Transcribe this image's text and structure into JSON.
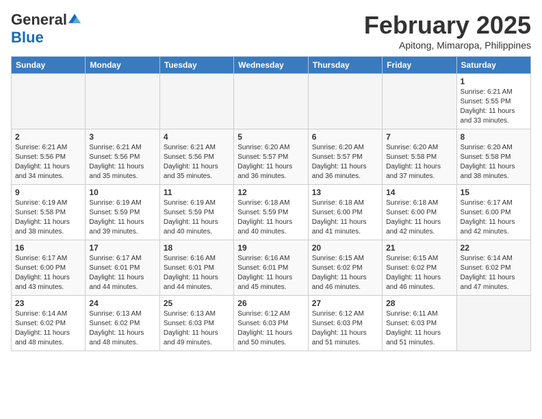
{
  "logo": {
    "general": "General",
    "blue": "Blue"
  },
  "title": "February 2025",
  "location": "Apitong, Mimaropa, Philippines",
  "weekdays": [
    "Sunday",
    "Monday",
    "Tuesday",
    "Wednesday",
    "Thursday",
    "Friday",
    "Saturday"
  ],
  "weeks": [
    [
      {
        "day": "",
        "info": ""
      },
      {
        "day": "",
        "info": ""
      },
      {
        "day": "",
        "info": ""
      },
      {
        "day": "",
        "info": ""
      },
      {
        "day": "",
        "info": ""
      },
      {
        "day": "",
        "info": ""
      },
      {
        "day": "1",
        "info": "Sunrise: 6:21 AM\nSunset: 5:55 PM\nDaylight: 11 hours\nand 33 minutes."
      }
    ],
    [
      {
        "day": "2",
        "info": "Sunrise: 6:21 AM\nSunset: 5:56 PM\nDaylight: 11 hours\nand 34 minutes."
      },
      {
        "day": "3",
        "info": "Sunrise: 6:21 AM\nSunset: 5:56 PM\nDaylight: 11 hours\nand 35 minutes."
      },
      {
        "day": "4",
        "info": "Sunrise: 6:21 AM\nSunset: 5:56 PM\nDaylight: 11 hours\nand 35 minutes."
      },
      {
        "day": "5",
        "info": "Sunrise: 6:20 AM\nSunset: 5:57 PM\nDaylight: 11 hours\nand 36 minutes."
      },
      {
        "day": "6",
        "info": "Sunrise: 6:20 AM\nSunset: 5:57 PM\nDaylight: 11 hours\nand 36 minutes."
      },
      {
        "day": "7",
        "info": "Sunrise: 6:20 AM\nSunset: 5:58 PM\nDaylight: 11 hours\nand 37 minutes."
      },
      {
        "day": "8",
        "info": "Sunrise: 6:20 AM\nSunset: 5:58 PM\nDaylight: 11 hours\nand 38 minutes."
      }
    ],
    [
      {
        "day": "9",
        "info": "Sunrise: 6:19 AM\nSunset: 5:58 PM\nDaylight: 11 hours\nand 38 minutes."
      },
      {
        "day": "10",
        "info": "Sunrise: 6:19 AM\nSunset: 5:59 PM\nDaylight: 11 hours\nand 39 minutes."
      },
      {
        "day": "11",
        "info": "Sunrise: 6:19 AM\nSunset: 5:59 PM\nDaylight: 11 hours\nand 40 minutes."
      },
      {
        "day": "12",
        "info": "Sunrise: 6:18 AM\nSunset: 5:59 PM\nDaylight: 11 hours\nand 40 minutes."
      },
      {
        "day": "13",
        "info": "Sunrise: 6:18 AM\nSunset: 6:00 PM\nDaylight: 11 hours\nand 41 minutes."
      },
      {
        "day": "14",
        "info": "Sunrise: 6:18 AM\nSunset: 6:00 PM\nDaylight: 11 hours\nand 42 minutes."
      },
      {
        "day": "15",
        "info": "Sunrise: 6:17 AM\nSunset: 6:00 PM\nDaylight: 11 hours\nand 42 minutes."
      }
    ],
    [
      {
        "day": "16",
        "info": "Sunrise: 6:17 AM\nSunset: 6:00 PM\nDaylight: 11 hours\nand 43 minutes."
      },
      {
        "day": "17",
        "info": "Sunrise: 6:17 AM\nSunset: 6:01 PM\nDaylight: 11 hours\nand 44 minutes."
      },
      {
        "day": "18",
        "info": "Sunrise: 6:16 AM\nSunset: 6:01 PM\nDaylight: 11 hours\nand 44 minutes."
      },
      {
        "day": "19",
        "info": "Sunrise: 6:16 AM\nSunset: 6:01 PM\nDaylight: 11 hours\nand 45 minutes."
      },
      {
        "day": "20",
        "info": "Sunrise: 6:15 AM\nSunset: 6:02 PM\nDaylight: 11 hours\nand 46 minutes."
      },
      {
        "day": "21",
        "info": "Sunrise: 6:15 AM\nSunset: 6:02 PM\nDaylight: 11 hours\nand 46 minutes."
      },
      {
        "day": "22",
        "info": "Sunrise: 6:14 AM\nSunset: 6:02 PM\nDaylight: 11 hours\nand 47 minutes."
      }
    ],
    [
      {
        "day": "23",
        "info": "Sunrise: 6:14 AM\nSunset: 6:02 PM\nDaylight: 11 hours\nand 48 minutes."
      },
      {
        "day": "24",
        "info": "Sunrise: 6:13 AM\nSunset: 6:02 PM\nDaylight: 11 hours\nand 48 minutes."
      },
      {
        "day": "25",
        "info": "Sunrise: 6:13 AM\nSunset: 6:03 PM\nDaylight: 11 hours\nand 49 minutes."
      },
      {
        "day": "26",
        "info": "Sunrise: 6:12 AM\nSunset: 6:03 PM\nDaylight: 11 hours\nand 50 minutes."
      },
      {
        "day": "27",
        "info": "Sunrise: 6:12 AM\nSunset: 6:03 PM\nDaylight: 11 hours\nand 51 minutes."
      },
      {
        "day": "28",
        "info": "Sunrise: 6:11 AM\nSunset: 6:03 PM\nDaylight: 11 hours\nand 51 minutes."
      },
      {
        "day": "",
        "info": ""
      }
    ]
  ]
}
